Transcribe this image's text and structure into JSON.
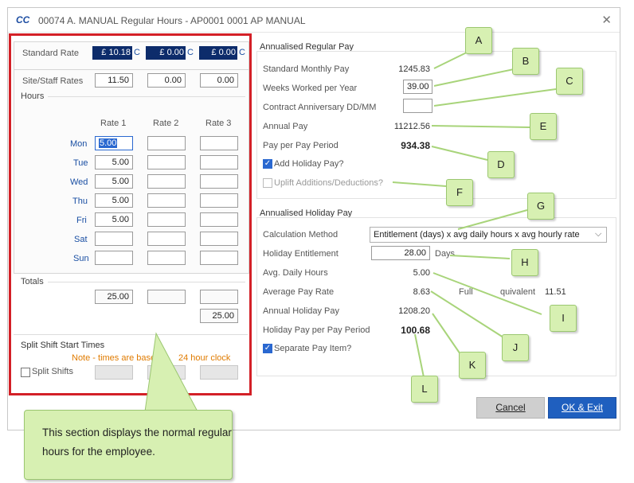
{
  "window": {
    "logo": "CC",
    "title": "00074 A. MANUAL  Regular Hours - AP0001 0001 AP MANUAL",
    "close": "✕"
  },
  "left": {
    "standard_rate_label": "Standard Rate",
    "standard_rates": [
      "£ 10.18",
      "£ 0.00",
      "£ 0.00"
    ],
    "rate_suffix": "C",
    "site_staff_label": "Site/Staff Rates",
    "site_staff_rates": [
      "11.50",
      "0.00",
      "0.00"
    ],
    "hours_label": "Hours",
    "rate_headers": [
      "Rate 1",
      "Rate 2",
      "Rate 3"
    ],
    "days": [
      {
        "day": "Mon",
        "values": [
          "5.00",
          "",
          ""
        ]
      },
      {
        "day": "Tue",
        "values": [
          "5.00",
          "",
          ""
        ]
      },
      {
        "day": "Wed",
        "values": [
          "5.00",
          "",
          ""
        ]
      },
      {
        "day": "Thu",
        "values": [
          "5.00",
          "",
          ""
        ]
      },
      {
        "day": "Fri",
        "values": [
          "5.00",
          "",
          ""
        ]
      },
      {
        "day": "Sat",
        "values": [
          "",
          "",
          ""
        ]
      },
      {
        "day": "Sun",
        "values": [
          "",
          "",
          ""
        ]
      }
    ],
    "totals_label": "Totals",
    "totals": [
      "25.00",
      "",
      ""
    ],
    "grand_total": "25.00",
    "split_shift_title": "Split Shift Start Times",
    "note_visible_a": "Note - times are base",
    "note_visible_b": "24 hour clock",
    "split_shifts_label": "Split Shifts"
  },
  "regular": {
    "title": "Annualised Regular Pay",
    "standard_monthly_label": "Standard Monthly Pay",
    "standard_monthly": "1245.83",
    "weeks_label": "Weeks Worked per Year",
    "weeks": "39.00",
    "anniversary_label": "Contract Anniversary DD/MM",
    "anniversary": "",
    "annual_pay_label": "Annual Pay",
    "annual_pay": "11212.56",
    "per_period_label": "Pay per Pay Period",
    "per_period": "934.38",
    "add_holiday_label": "Add Holiday Pay?",
    "uplift_label": "Uplift Additions/Deductions?"
  },
  "holiday": {
    "title": "Annualised Holiday Pay",
    "method_label": "Calculation Method",
    "method_value": "Entitlement (days) x avg daily hours x avg hourly rate",
    "entitlement_label": "Holiday Entitlement",
    "entitlement": "28.00",
    "entitlement_unit": "Days",
    "daily_hours_label": "Avg. Daily Hours",
    "daily_hours": "5.00",
    "avg_rate_label": "Average Pay Rate",
    "avg_rate": "8.63",
    "fte_visible_a": "Full",
    "fte_visible_b": "quivalent",
    "fte_value": "11.51",
    "annual_holiday_label": "Annual Holiday Pay",
    "annual_holiday": "1208.20",
    "holiday_per_period_label": "Holiday Pay per Pay Period",
    "holiday_per_period": "100.68",
    "separate_label": "Separate Pay Item?"
  },
  "buttons": {
    "cancel": "Cancel",
    "ok": "OK & Exit"
  },
  "callouts": [
    "A",
    "B",
    "C",
    "D",
    "E",
    "F",
    "G",
    "H",
    "I",
    "J",
    "K",
    "L"
  ],
  "big_callout": "This section displays the normal regular hours for the employee.",
  "colors": {
    "highlight_frame": "#d32027",
    "callout_fill": "#d7f0b2",
    "ok_button": "#1f5fbf",
    "rate_box": "#0d2c6b"
  }
}
